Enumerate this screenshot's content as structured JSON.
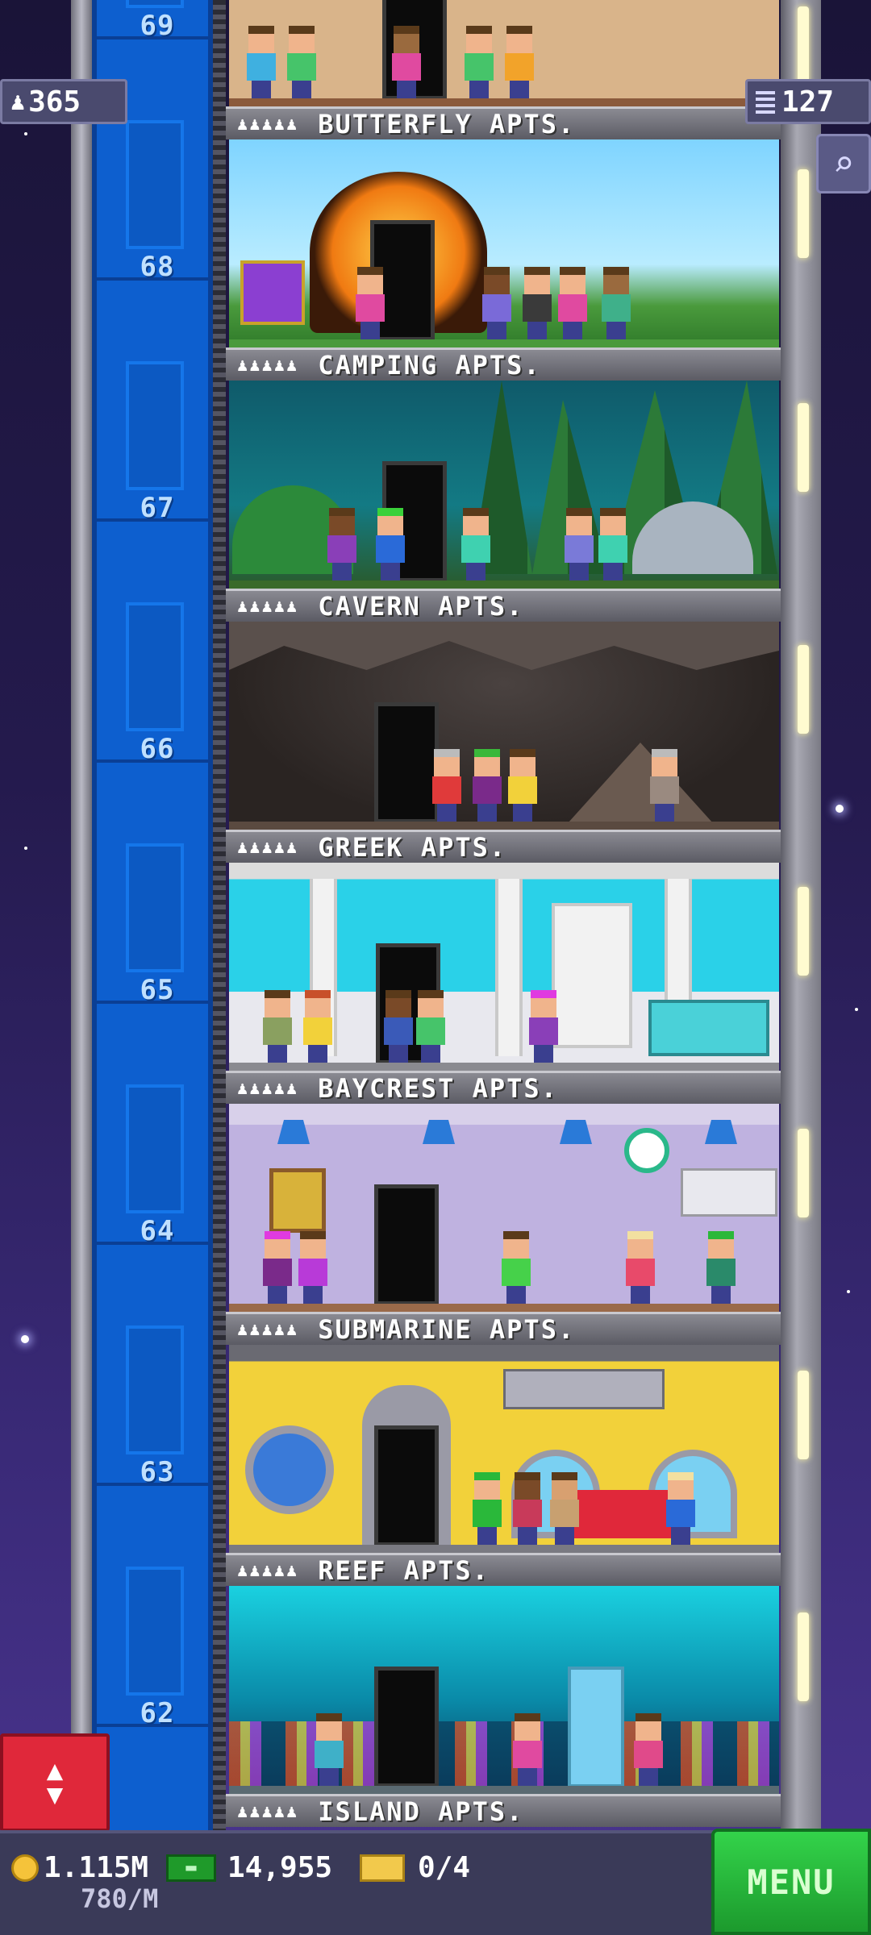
{
  "hud": {
    "population": "365",
    "population_icon": "person-icon",
    "floor_count": "127",
    "floor_count_icon": "building-icon",
    "search_icon": "magnifier-icon"
  },
  "floors": [
    {
      "number": "69",
      "name": "",
      "theme": "apartment-top"
    },
    {
      "number": "68",
      "name": "BUTTERFLY APTS.",
      "theme": "butterfly"
    },
    {
      "number": "67",
      "name": "CAMPING APTS.",
      "theme": "camping"
    },
    {
      "number": "66",
      "name": "CAVERN APTS.",
      "theme": "cavern"
    },
    {
      "number": "65",
      "name": "GREEK APTS.",
      "theme": "greek"
    },
    {
      "number": "64",
      "name": "BAYCREST APTS.",
      "theme": "baycrest"
    },
    {
      "number": "63",
      "name": "SUBMARINE APTS.",
      "theme": "submarine"
    },
    {
      "number": "62",
      "name": "REEF APTS.",
      "theme": "reef"
    },
    {
      "number": "",
      "name": "ISLAND APTS.",
      "theme": "island"
    }
  ],
  "rating_stars": "♟♟♟♟♟",
  "bottom": {
    "coins": "1.115M",
    "bux": "14,955",
    "tickets": "0/4",
    "coin_rate": "780/M",
    "menu_label": "MENU"
  },
  "colors": {
    "elevator_blue": "#0d5fcf",
    "elevator_button_red": "#e0283a",
    "menu_green": "#2bc03e",
    "hud_panel": "#4a4a6e"
  }
}
